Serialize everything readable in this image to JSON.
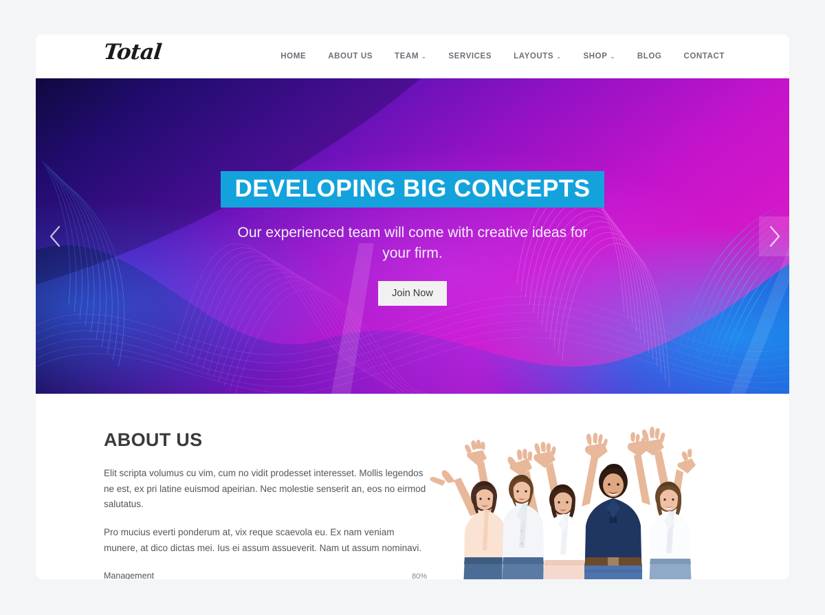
{
  "site": {
    "logo_text": "Total"
  },
  "nav": {
    "items": [
      {
        "label": "HOME",
        "has_dropdown": false
      },
      {
        "label": "ABOUT US",
        "has_dropdown": false
      },
      {
        "label": "TEAM",
        "has_dropdown": true
      },
      {
        "label": "SERVICES",
        "has_dropdown": false
      },
      {
        "label": "LAYOUTS",
        "has_dropdown": true
      },
      {
        "label": "SHOP",
        "has_dropdown": true
      },
      {
        "label": "BLOG",
        "has_dropdown": false
      },
      {
        "label": "CONTACT",
        "has_dropdown": false
      }
    ],
    "caret_glyph": "⌄"
  },
  "hero": {
    "title": "DEVELOPING BIG CONCEPTS",
    "subtitle": "Our experienced team will come with creative ideas for your firm.",
    "cta_label": "Join Now",
    "prev_arrow": "chevron-left",
    "next_arrow": "chevron-right",
    "title_bg_color": "#14a2dc",
    "gradient_from": "#140a4a",
    "gradient_mid": "#7a13bd",
    "gradient_to": "#d817c8"
  },
  "about": {
    "title": "ABOUT US",
    "paragraphs": [
      "Elit scripta volumus cu vim, cum no vidit prodesset interesset. Mollis legendos ne est, ex pri latine euismod apeirian. Nec molestie senserit an, eos no eirmod salutatus.",
      "Pro mucius everti ponderum at, vix reque scaevola eu. Ex nam veniam munere, at dico dictas mei. Ius ei assum assueverit. Nam ut assum nominavi."
    ],
    "skills": [
      {
        "label": "Management",
        "percent_label": "80%",
        "percent": 80
      }
    ],
    "photo_alt": "group-of-five-people-celebrating-with-raised-arms",
    "accent_color": "#1b9ce4"
  }
}
